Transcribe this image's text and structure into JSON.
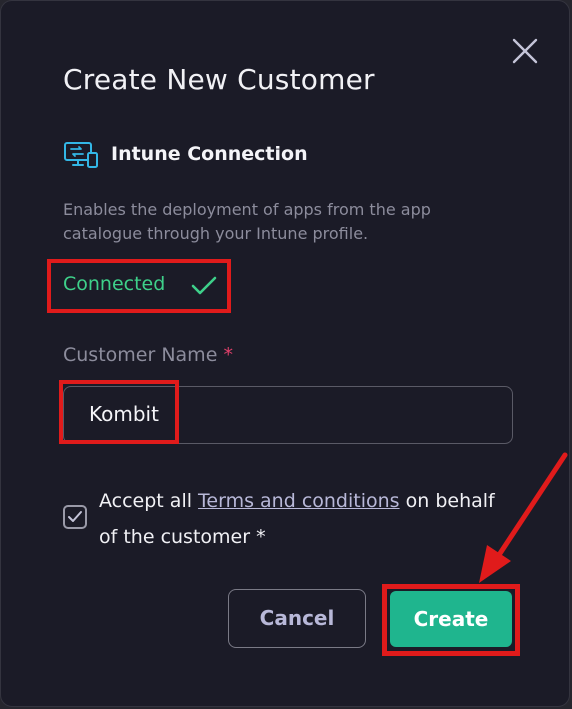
{
  "dialog": {
    "title": "Create New Customer",
    "close_icon": "close-icon"
  },
  "intune": {
    "icon": "monitor-sync-icon",
    "title": "Intune Connection",
    "description": "Enables the deployment of apps from the app catalogue through your Intune profile.",
    "status": "Connected",
    "status_icon": "check-icon",
    "status_color": "#3ed08a"
  },
  "customer_name": {
    "label": "Customer Name",
    "required_marker": "*",
    "value": "Kombit"
  },
  "terms": {
    "checked": true,
    "text_before": "Accept all ",
    "link": "Terms and conditions",
    "text_after": " on behalf of the customer *"
  },
  "actions": {
    "cancel_label": "Cancel",
    "create_label": "Create"
  },
  "colors": {
    "background": "#1b1b27",
    "accent": "#1fb58e",
    "highlight": "#e01b1b",
    "required": "#e0406a"
  }
}
